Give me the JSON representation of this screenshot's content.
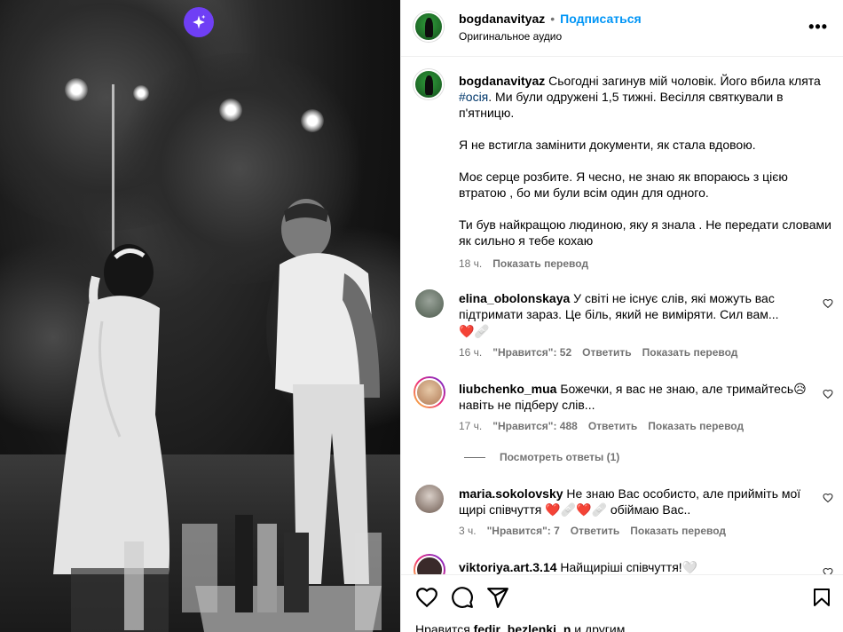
{
  "media": {
    "sparkle_icon": "sparkle-icon",
    "accent": "#6f3ff5"
  },
  "header": {
    "username": "bogdanavityaz",
    "separator": "•",
    "follow_label": "Подписаться",
    "audio": "Оригинальное аудио",
    "more_icon": "•••"
  },
  "caption": {
    "username": "bogdanavityaz",
    "text_1": "Сьогодні загинув мій чоловік. Його вбила клята ",
    "hashtag": "#осія",
    "text_2": ". Ми були одружені 1,5 тижні. Весілля святкували в п'ятницю.",
    "para_2": "Я не встигла замінити документи, як стала вдовою.",
    "para_3": "Моє серце розбите. Я чесно, не знаю як впораюсь з цією втратою , бо ми були всім один для одного.",
    "para_4": "Ти був найкращою людиною, яку я знала . Не передати словами як сильно я тебе кохаю",
    "time": "18 ч.",
    "translate": "Показать перевод"
  },
  "comments": [
    {
      "username": "elina_obolonskaya",
      "text": "У світі не існує слів, які можуть вас підтримати зараз. Це біль, який не виміряти. Сил вам...",
      "emoji": "❤️🩹",
      "time": "16 ч.",
      "likes": "\"Нравится\": 52",
      "reply": "Ответить",
      "translate": "Показать перевод"
    },
    {
      "username": "liubchenko_mua",
      "text": "Божечки, я вас не знаю, але тримайтесь😥 навіть не підберу слів...",
      "time": "17 ч.",
      "likes": "\"Нравится\": 488",
      "reply": "Ответить",
      "translate": "Показать перевод",
      "view_replies": "Посмотреть ответы (1)"
    },
    {
      "username": "maria.sokolovsky",
      "text": "Не знаю Вас особисто, але прийміть мої щирі співчуття ❤️🩹❤️🩹 обіймаю Вас..",
      "time": "3 ч.",
      "likes": "\"Нравится\": 7",
      "reply": "Ответить",
      "translate": "Показать перевод"
    },
    {
      "username": "viktoriya.art.3.14",
      "text": "Найщиріші співчуття!🤍"
    }
  ],
  "actions": {
    "like_icon": "heart-icon",
    "comment_icon": "comment-icon",
    "share_icon": "share-icon",
    "save_icon": "bookmark-icon",
    "likes_prefix": "Нравится ",
    "likes_user": "fedir_bezlenki_n",
    "likes_suffix": " и другим"
  }
}
